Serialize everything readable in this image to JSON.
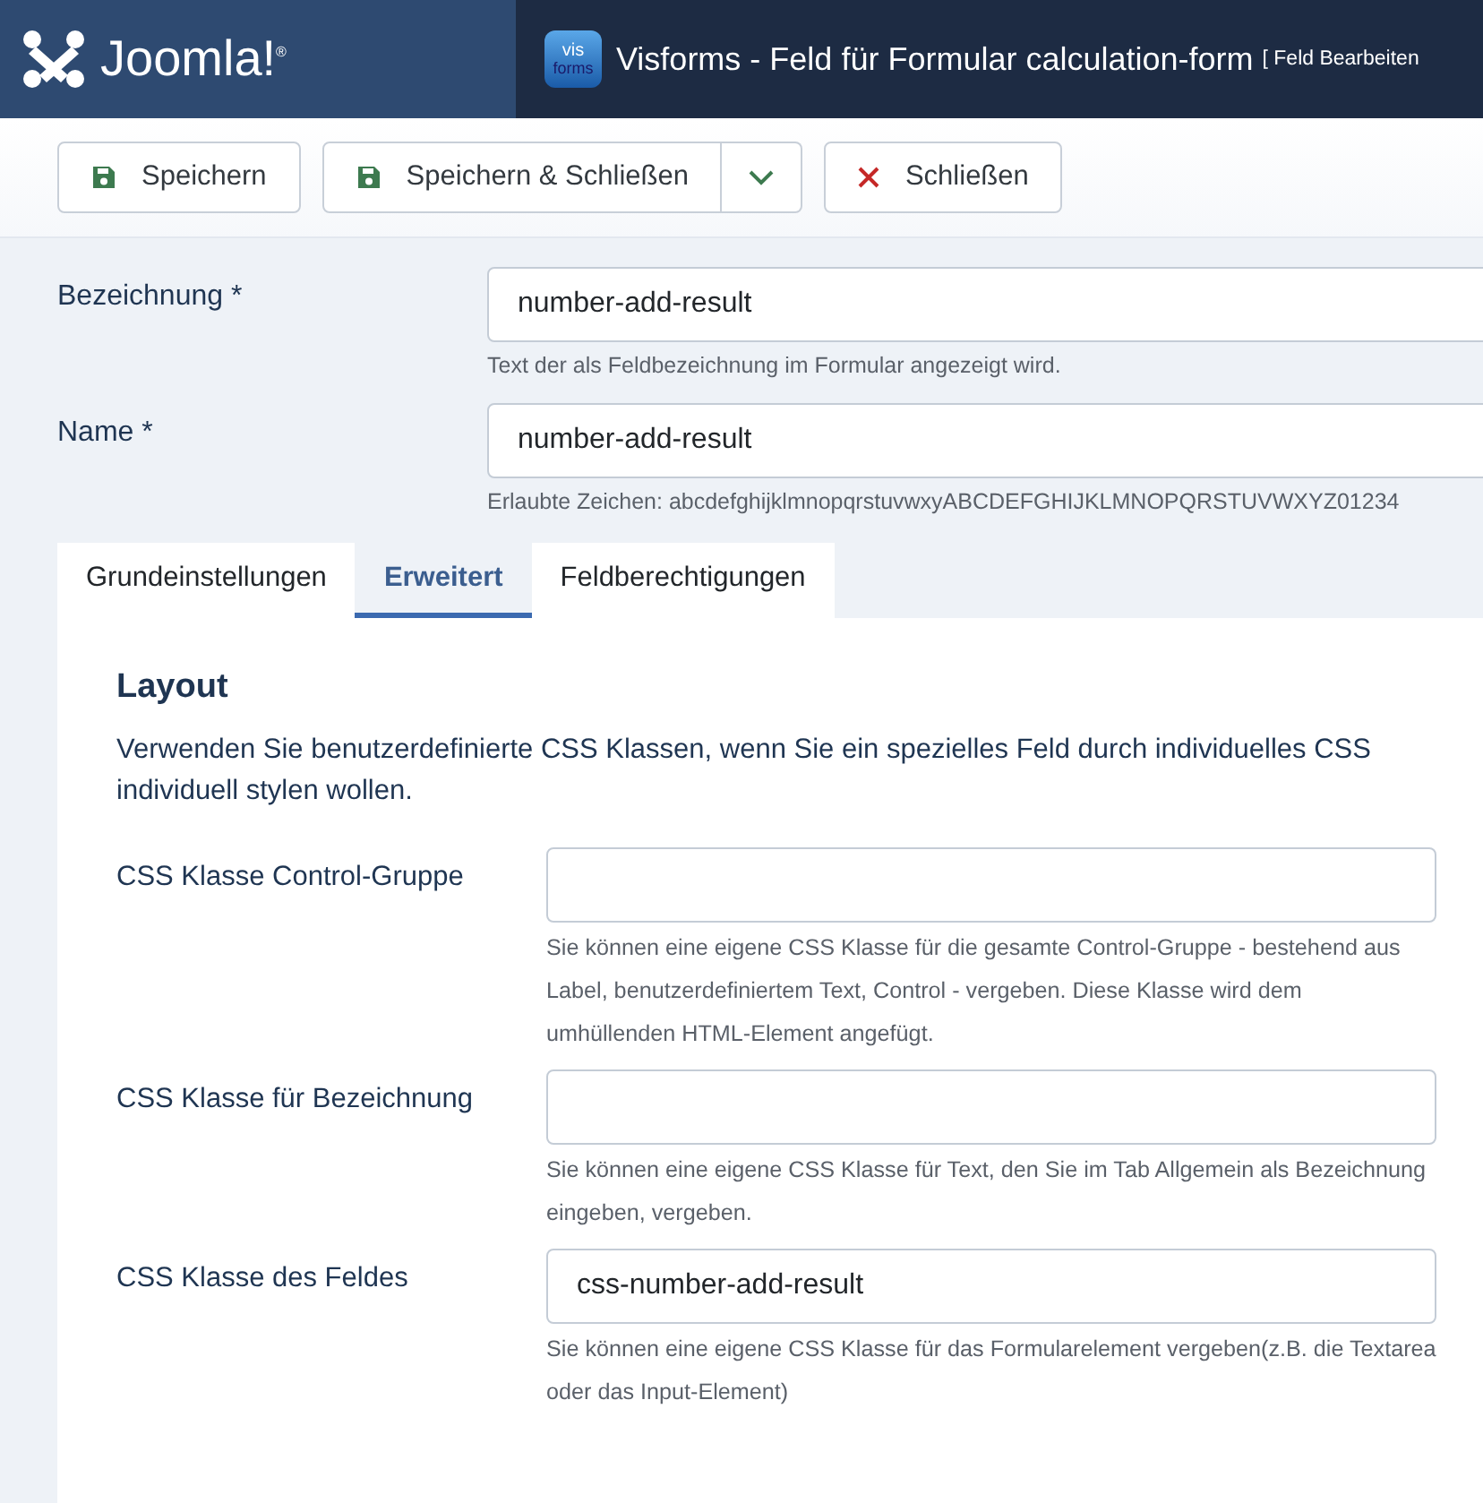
{
  "header": {
    "brand": "Joomla!$^{®}$",
    "app_icon_text": [
      "vis",
      "forms"
    ],
    "title": "Visforms - Feld für Formular calculation-form",
    "subtitle": "[ Feld Bearbeiten"
  },
  "toolbar": {
    "buttons": [
      {
        "kind": "save",
        "label": "Speichern"
      },
      {
        "kind": "save-split",
        "label": "Speichern & Schließen"
      },
      {
        "kind": "close",
        "label": "Schließen"
      }
    ]
  },
  "fields": [
    {
      "label": "Bezeichnung *",
      "value": "number-add-result",
      "hint": "Text der als Feldbezeichnung im Formular angezeigt wird."
    },
    {
      "label": "Name *",
      "value": "number-add-result",
      "hint": "Erlaubte Zeichen: abcdefghijklmnopqrstuvwxyABCDEFGHIJKLMNOPQRSTUVWXYZ01234"
    }
  ],
  "tabs": [
    {
      "label": "Grundeinstellungen",
      "selected": false
    },
    {
      "label": "Erweitert",
      "selected": true
    },
    {
      "label": "Feldberechtigungen",
      "selected": false
    }
  ],
  "panel": {
    "heading": "Layout",
    "description": "Verwenden Sie benutzerdefinierte CSS Klassen, wenn Sie ein spezielles Feld durch individuelles CSS individuell stylen wollen.",
    "fields": [
      {
        "label": "CSS Klasse Control-Gruppe",
        "hint": "Sie können eine eigene CSS Klasse für die gesamte Control-Gruppe - bestehend aus Label, benutzerdefiniertem Text, Control - vergeben. Diese Klasse wird dem umhüllenden HTML-Element angefügt."
      },
      {
        "label": "CSS Klasse für Bezeichnung",
        "hint": "Sie können eine eigene CSS Klasse für Text, den Sie im Tab Allgemein als Bezeichnung eingeben, vergeben."
      },
      {
        "label": "CSS Klasse des Feldes",
        "value": "css-number-add-result",
        "hint": "Sie können eine eigene CSS Klasse für das Formularelement vergeben(z.B. die Textarea oder das Input-Element)"
      }
    ]
  }
}
